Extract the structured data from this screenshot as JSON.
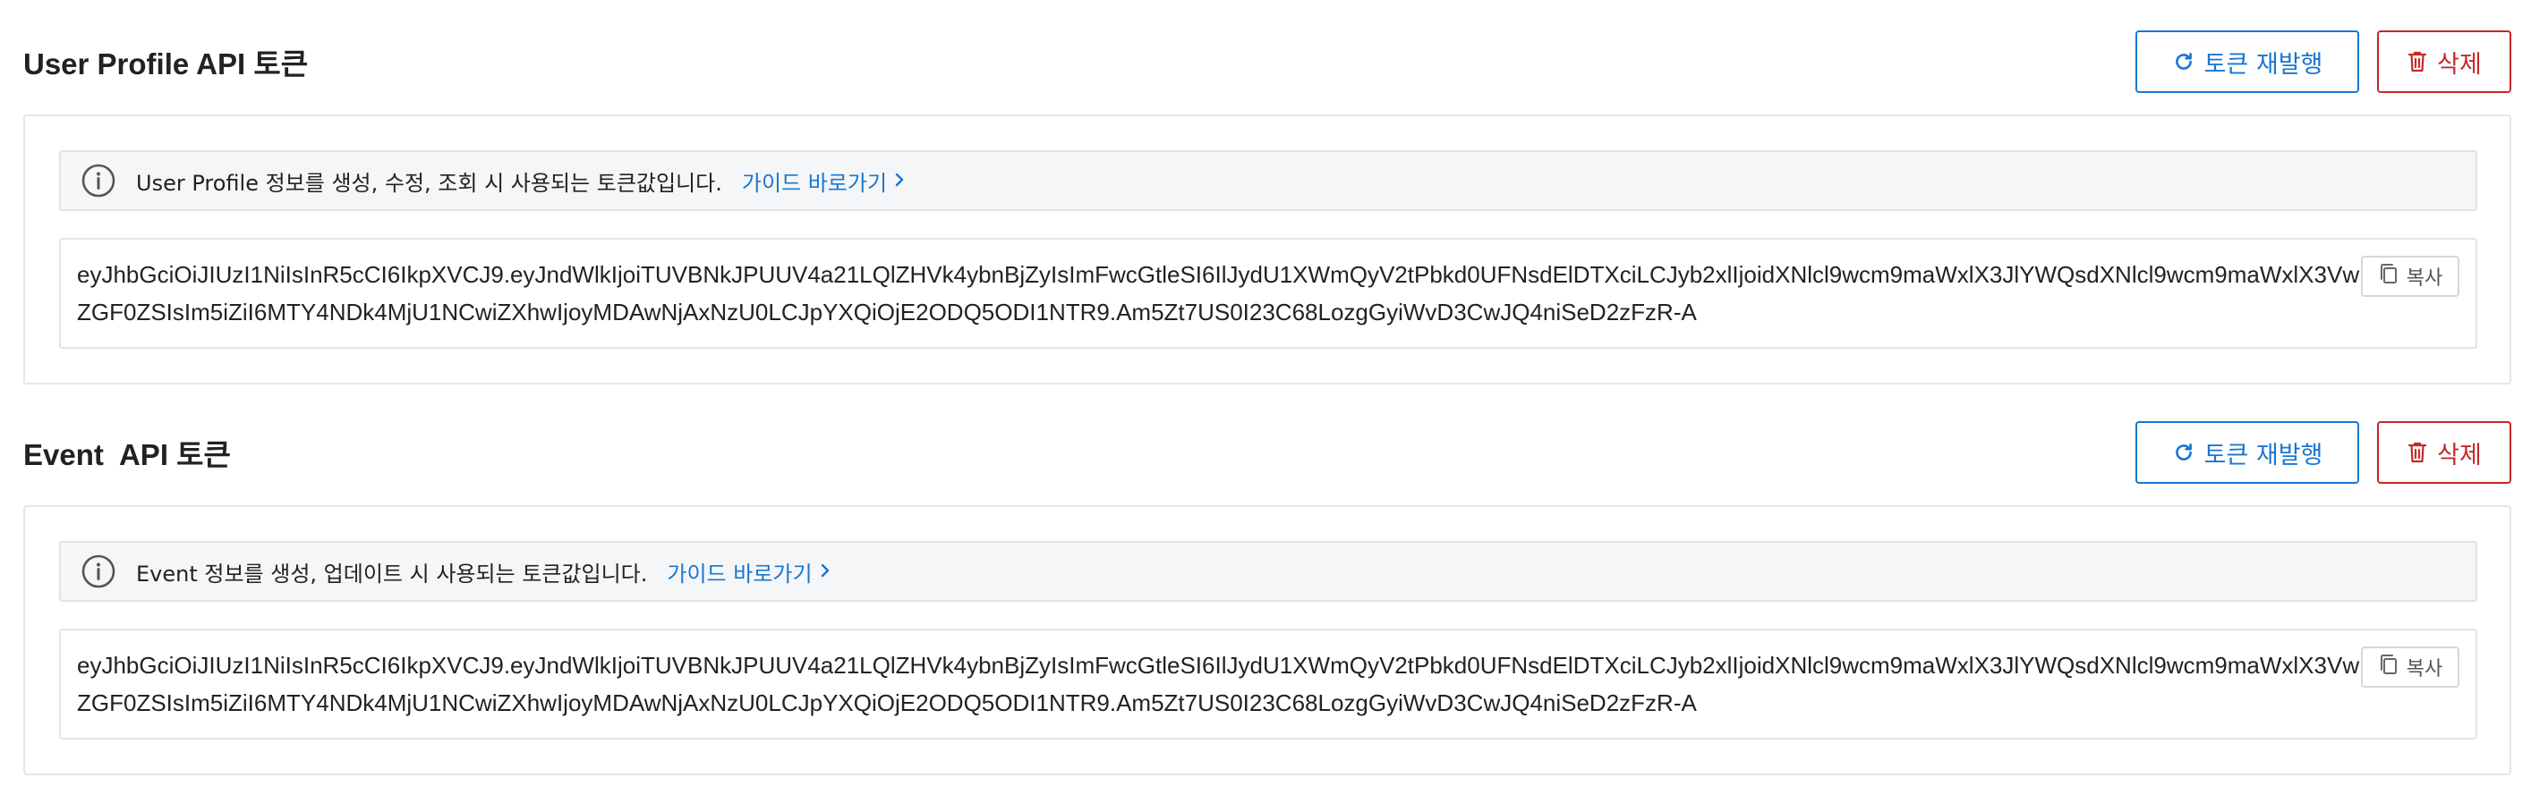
{
  "sections": [
    {
      "title": "User Profile API 토큰",
      "reissue_label": "토큰 재발행",
      "delete_label": "삭제",
      "info_text": "User Profile 정보를 생성, 수정, 조회 시 사용되는 토큰값입니다.",
      "guide_label": "가이드 바로가기",
      "token": "eyJhbGciOiJIUzI1NiIsInR5cCI6IkpXVCJ9.eyJndWlkIjoiTUVBNkJPUUV4a21LQlZHVk4ybnBjZyIsImFwcGtleSI6IlJydU1XWmQyV2tPbkd0UFNsdElDTXciLCJyb2xlIjoidXNlcl9wcm9maWxlX3JlYWQsdXNlcl9wcm9maWxlX3VwZGF0ZSIsIm5iZiI6MTY4NDk4MjU1NCwiZXhwIjoyMDAwNjAxNzU0LCJpYXQiOjE2ODQ5ODI1NTR9.Am5Zt7US0I23C68LozgGyiWvD3CwJQ4niSeD2zFzR-A",
      "copy_label": "복사"
    },
    {
      "title": "Event  API 토큰",
      "reissue_label": "토큰 재발행",
      "delete_label": "삭제",
      "info_text": "Event 정보를 생성, 업데이트 시 사용되는 토큰값입니다.",
      "guide_label": "가이드 바로가기",
      "token": "eyJhbGciOiJIUzI1NiIsInR5cCI6IkpXVCJ9.eyJndWlkIjoiTUVBNkJPUUV4a21LQlZHVk4ybnBjZyIsImFwcGtleSI6IlJydU1XWmQyV2tPbkd0UFNsdElDTXciLCJyb2xlIjoidXNlcl9wcm9maWxlX3JlYWQsdXNlcl9wcm9maWxlX3VwZGF0ZSIsIm5iZiI6MTY4NDk4MjU1NCwiZXhwIjoyMDAwNjAxNzU0LCJpYXQiOjE2ODQ5ODI1NTR9.Am5Zt7US0I23C68LozgGyiWvD3CwJQ4niSeD2zFzR-A",
      "copy_label": "복사"
    }
  ],
  "icons": {
    "reissue": "refresh-icon",
    "delete": "trash-icon",
    "info": "info-circle-icon",
    "guide": "chevron-right-icon",
    "copy": "copy-icon"
  },
  "colors": {
    "primary": "#1976d2",
    "danger": "#c62828",
    "info_bg": "#f5f6f7",
    "border": "#e2e4e6"
  }
}
